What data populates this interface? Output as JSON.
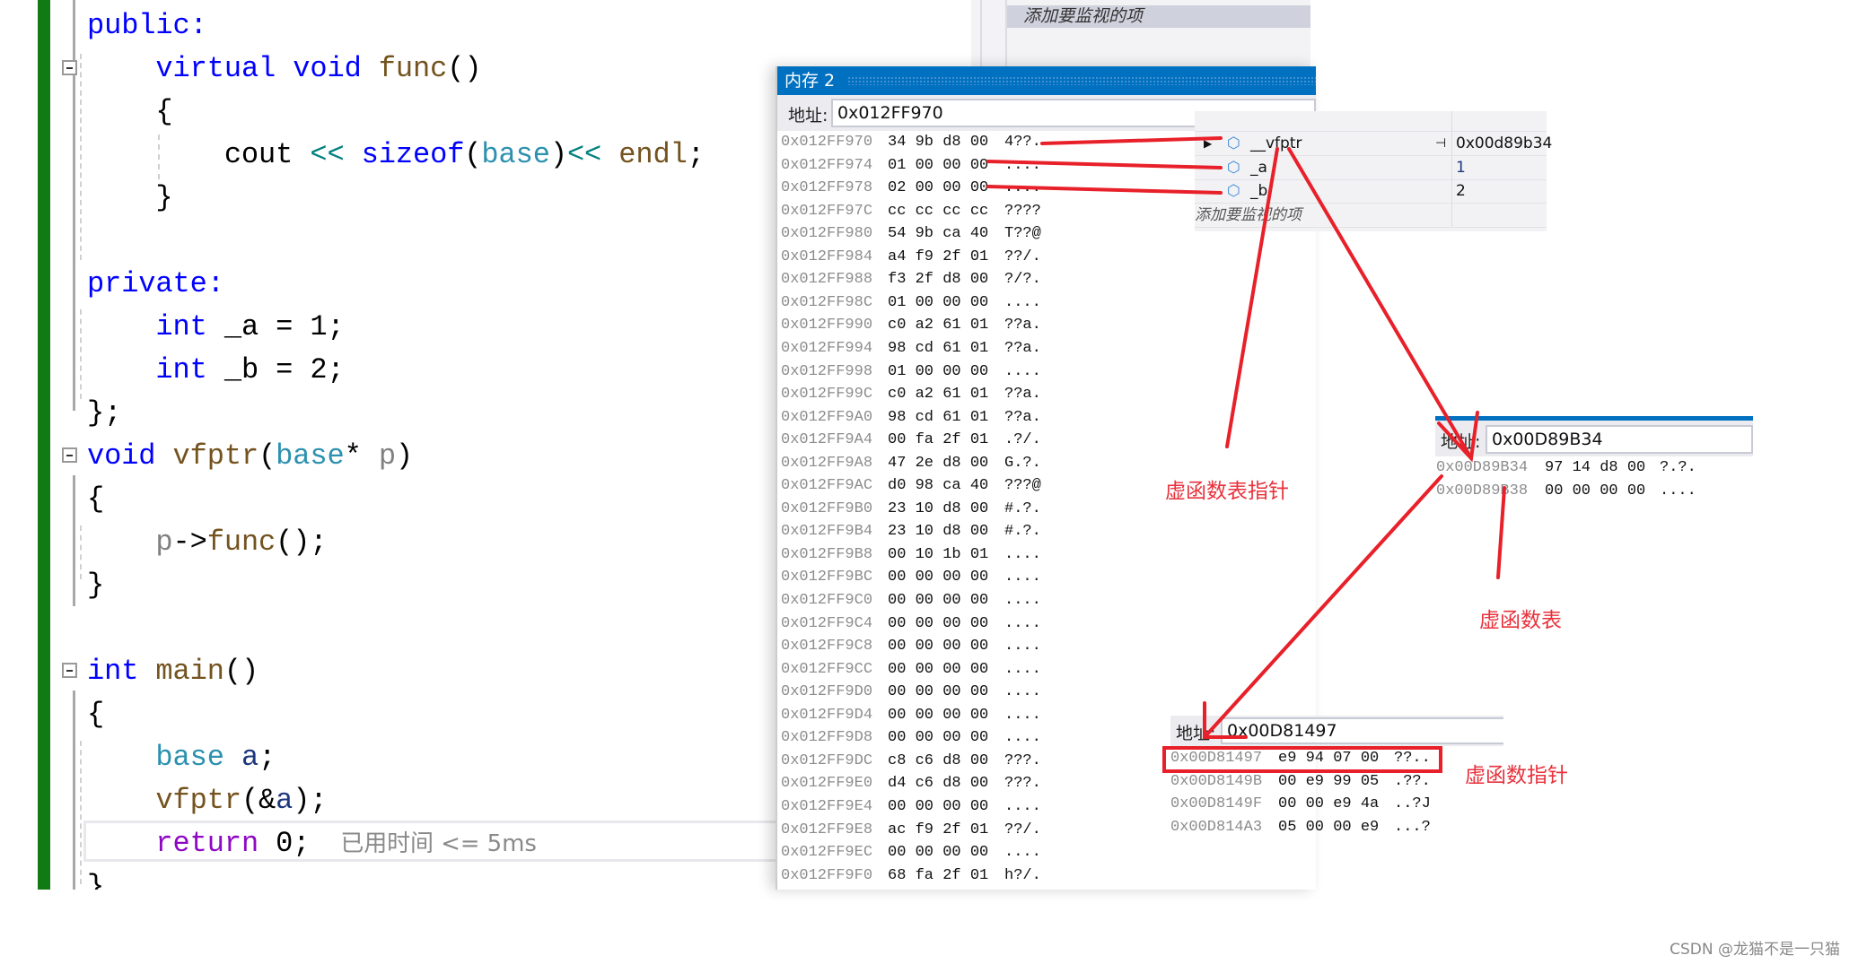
{
  "editor": {
    "lines": [
      {
        "tokens": [
          {
            "t": "public:",
            "c": "kw"
          }
        ]
      },
      {
        "tokens": [
          {
            "t": "    ",
            "c": ""
          },
          {
            "t": "virtual",
            "c": "kw"
          },
          {
            "t": " ",
            "c": ""
          },
          {
            "t": "void",
            "c": "kw"
          },
          {
            "t": " ",
            "c": ""
          },
          {
            "t": "func",
            "c": "fn"
          },
          {
            "t": "()",
            "c": ""
          }
        ]
      },
      {
        "tokens": [
          {
            "t": "    {",
            "c": ""
          }
        ]
      },
      {
        "tokens": [
          {
            "t": "        cout ",
            "c": ""
          },
          {
            "t": "<<",
            "c": "op"
          },
          {
            "t": " ",
            "c": ""
          },
          {
            "t": "sizeof",
            "c": "kw"
          },
          {
            "t": "(",
            "c": ""
          },
          {
            "t": "base",
            "c": "ty"
          },
          {
            "t": ")",
            "c": ""
          },
          {
            "t": "<<",
            "c": "op"
          },
          {
            "t": " ",
            "c": ""
          },
          {
            "t": "endl",
            "c": "fn"
          },
          {
            "t": ";",
            "c": ""
          }
        ]
      },
      {
        "tokens": [
          {
            "t": "    }",
            "c": ""
          }
        ]
      },
      {
        "tokens": []
      },
      {
        "tokens": [
          {
            "t": "private:",
            "c": "kw"
          }
        ]
      },
      {
        "tokens": [
          {
            "t": "    ",
            "c": ""
          },
          {
            "t": "int",
            "c": "kw"
          },
          {
            "t": " _a = 1;",
            "c": ""
          }
        ]
      },
      {
        "tokens": [
          {
            "t": "    ",
            "c": ""
          },
          {
            "t": "int",
            "c": "kw"
          },
          {
            "t": " _b = 2;",
            "c": ""
          }
        ]
      },
      {
        "tokens": [
          {
            "t": "};",
            "c": ""
          }
        ]
      },
      {
        "tokens": [
          {
            "t": "void",
            "c": "kw"
          },
          {
            "t": " ",
            "c": ""
          },
          {
            "t": "vfptr",
            "c": "fn"
          },
          {
            "t": "(",
            "c": ""
          },
          {
            "t": "base",
            "c": "ty"
          },
          {
            "t": "* ",
            "c": ""
          },
          {
            "t": "p",
            "c": "pm"
          },
          {
            "t": ")",
            "c": ""
          }
        ]
      },
      {
        "tokens": [
          {
            "t": "{",
            "c": ""
          }
        ]
      },
      {
        "tokens": [
          {
            "t": "    ",
            "c": ""
          },
          {
            "t": "p",
            "c": "pm"
          },
          {
            "t": "->",
            "c": ""
          },
          {
            "t": "func",
            "c": "fn"
          },
          {
            "t": "();",
            "c": ""
          }
        ]
      },
      {
        "tokens": [
          {
            "t": "}",
            "c": ""
          }
        ]
      },
      {
        "tokens": []
      },
      {
        "tokens": [
          {
            "t": "int",
            "c": "kw"
          },
          {
            "t": " ",
            "c": ""
          },
          {
            "t": "main",
            "c": "fn"
          },
          {
            "t": "()",
            "c": ""
          }
        ]
      },
      {
        "tokens": [
          {
            "t": "{",
            "c": ""
          }
        ]
      },
      {
        "tokens": [
          {
            "t": "    ",
            "c": ""
          },
          {
            "t": "base",
            "c": "ty"
          },
          {
            "t": " ",
            "c": ""
          },
          {
            "t": "a",
            "c": "var"
          },
          {
            "t": ";",
            "c": ""
          }
        ]
      },
      {
        "tokens": [
          {
            "t": "    ",
            "c": ""
          },
          {
            "t": "vfptr",
            "c": "fn"
          },
          {
            "t": "(&",
            "c": ""
          },
          {
            "t": "a",
            "c": "var"
          },
          {
            "t": ");",
            "c": ""
          }
        ]
      },
      {
        "tokens": [
          {
            "t": "    ",
            "c": ""
          },
          {
            "t": "return",
            "c": "ret"
          },
          {
            "t": " 0;",
            "c": ""
          }
        ]
      },
      {
        "tokens": [
          {
            "t": "}",
            "c": ""
          }
        ]
      }
    ],
    "hint": "已用时间 <= 5ms"
  },
  "watch_top": {
    "add_item": "添加要监视的项"
  },
  "memory1": {
    "title": "内存 2",
    "address_label": "地址:",
    "address": "0x012FF970",
    "rows": [
      {
        "addr": "0x012FF970",
        "bytes": "34 9b d8 00",
        "ascii": "4??."
      },
      {
        "addr": "0x012FF974",
        "bytes": "01 00 00 00",
        "ascii": "...."
      },
      {
        "addr": "0x012FF978",
        "bytes": "02 00 00 00",
        "ascii": "...."
      },
      {
        "addr": "0x012FF97C",
        "bytes": "cc cc cc cc",
        "ascii": "????"
      },
      {
        "addr": "0x012FF980",
        "bytes": "54 9b ca 40",
        "ascii": "T??@"
      },
      {
        "addr": "0x012FF984",
        "bytes": "a4 f9 2f 01",
        "ascii": "??/."
      },
      {
        "addr": "0x012FF988",
        "bytes": "f3 2f d8 00",
        "ascii": "?/?."
      },
      {
        "addr": "0x012FF98C",
        "bytes": "01 00 00 00",
        "ascii": "...."
      },
      {
        "addr": "0x012FF990",
        "bytes": "c0 a2 61 01",
        "ascii": "??a."
      },
      {
        "addr": "0x012FF994",
        "bytes": "98 cd 61 01",
        "ascii": "??a."
      },
      {
        "addr": "0x012FF998",
        "bytes": "01 00 00 00",
        "ascii": "...."
      },
      {
        "addr": "0x012FF99C",
        "bytes": "c0 a2 61 01",
        "ascii": "??a."
      },
      {
        "addr": "0x012FF9A0",
        "bytes": "98 cd 61 01",
        "ascii": "??a."
      },
      {
        "addr": "0x012FF9A4",
        "bytes": "00 fa 2f 01",
        "ascii": ".?/."
      },
      {
        "addr": "0x012FF9A8",
        "bytes": "47 2e d8 00",
        "ascii": "G.?."
      },
      {
        "addr": "0x012FF9AC",
        "bytes": "d0 98 ca 40",
        "ascii": "???@"
      },
      {
        "addr": "0x012FF9B0",
        "bytes": "23 10 d8 00",
        "ascii": "#.?."
      },
      {
        "addr": "0x012FF9B4",
        "bytes": "23 10 d8 00",
        "ascii": "#.?."
      },
      {
        "addr": "0x012FF9B8",
        "bytes": "00 10 1b 01",
        "ascii": "...."
      },
      {
        "addr": "0x012FF9BC",
        "bytes": "00 00 00 00",
        "ascii": "...."
      },
      {
        "addr": "0x012FF9C0",
        "bytes": "00 00 00 00",
        "ascii": "...."
      },
      {
        "addr": "0x012FF9C4",
        "bytes": "00 00 00 00",
        "ascii": "...."
      },
      {
        "addr": "0x012FF9C8",
        "bytes": "00 00 00 00",
        "ascii": "...."
      },
      {
        "addr": "0x012FF9CC",
        "bytes": "00 00 00 00",
        "ascii": "...."
      },
      {
        "addr": "0x012FF9D0",
        "bytes": "00 00 00 00",
        "ascii": "...."
      },
      {
        "addr": "0x012FF9D4",
        "bytes": "00 00 00 00",
        "ascii": "...."
      },
      {
        "addr": "0x012FF9D8",
        "bytes": "00 00 00 00",
        "ascii": "...."
      },
      {
        "addr": "0x012FF9DC",
        "bytes": "c8 c6 d8 00",
        "ascii": "???."
      },
      {
        "addr": "0x012FF9E0",
        "bytes": "d4 c6 d8 00",
        "ascii": "???."
      },
      {
        "addr": "0x012FF9E4",
        "bytes": "00 00 00 00",
        "ascii": "...."
      },
      {
        "addr": "0x012FF9E8",
        "bytes": "ac f9 2f 01",
        "ascii": "??/."
      },
      {
        "addr": "0x012FF9EC",
        "bytes": "00 00 00 00",
        "ascii": "...."
      },
      {
        "addr": "0x012FF9F0",
        "bytes": "68 fa 2f 01",
        "ascii": "h?/."
      }
    ]
  },
  "watch": {
    "items": [
      {
        "name": "__vfptr",
        "value": "0x00d89b34"
      },
      {
        "name": "_a",
        "value": "1"
      },
      {
        "name": "_b",
        "value": "2"
      }
    ],
    "add_item": "添加要监视的项"
  },
  "memory2": {
    "address_label": "地址:",
    "address": "0x00D89B34",
    "rows": [
      {
        "addr": "0x00D89B34",
        "bytes": "97 14 d8 00",
        "ascii": "?.?."
      },
      {
        "addr": "0x00D89B38",
        "bytes": "00 00 00 00",
        "ascii": "...."
      }
    ]
  },
  "memory3": {
    "address_label": "地址:",
    "address": "0x00D81497",
    "rows": [
      {
        "addr": "0x00D81497",
        "bytes": "e9 94 07 00",
        "ascii": "??.."
      },
      {
        "addr": "0x00D8149B",
        "bytes": "00 e9 99 05",
        "ascii": ".??."
      },
      {
        "addr": "0x00D8149F",
        "bytes": "00 00 e9 4a",
        "ascii": "..?J"
      },
      {
        "addr": "0x00D814A3",
        "bytes": "05 00 00 e9",
        "ascii": "...?"
      }
    ]
  },
  "annotations": {
    "vtable_ptr": "虚函数表指针",
    "vtable": "虚函数表",
    "vfunc_ptr": "虚函数指针"
  },
  "watermark": "CSDN @龙猫不是一只猫",
  "colors": {
    "title_bar": "#0070c0",
    "annotation_red": "#e8202a",
    "keyword": "#0000ff",
    "type": "#2b91af",
    "function": "#74531f",
    "green_margin": "#127a12"
  }
}
